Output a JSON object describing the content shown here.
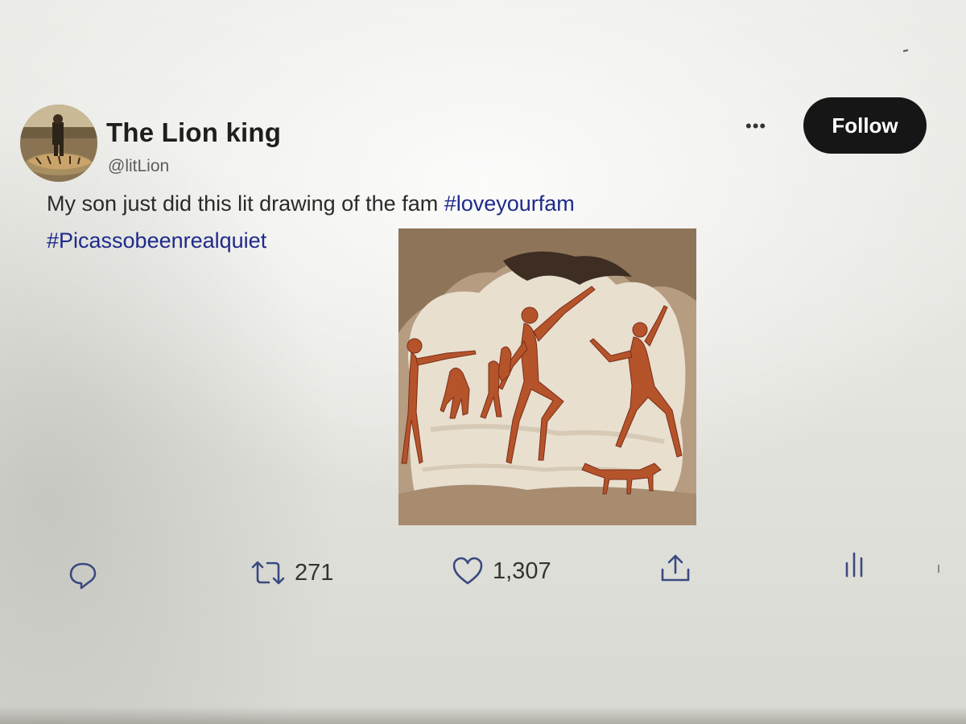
{
  "profile": {
    "display_name": "The Lion king",
    "handle": "@litLion"
  },
  "header": {
    "more_label": "•••",
    "follow_label": "Follow"
  },
  "tweet": {
    "text": "My son just did this lit drawing of the fam ",
    "hashtag1": "#loveyourfam",
    "hashtag2": "#Picassobeenrealquiet"
  },
  "actions": {
    "reply_icon": "reply-icon",
    "retweet_icon": "retweet-icon",
    "retweet_count": "271",
    "like_icon": "heart-icon",
    "like_count": "1,307",
    "share_icon": "share-icon",
    "analytics_icon": "analytics-icon"
  },
  "colors": {
    "follow_bg": "#161616",
    "hashtag": "#1e2a8a",
    "icon": "#3a4a80"
  }
}
